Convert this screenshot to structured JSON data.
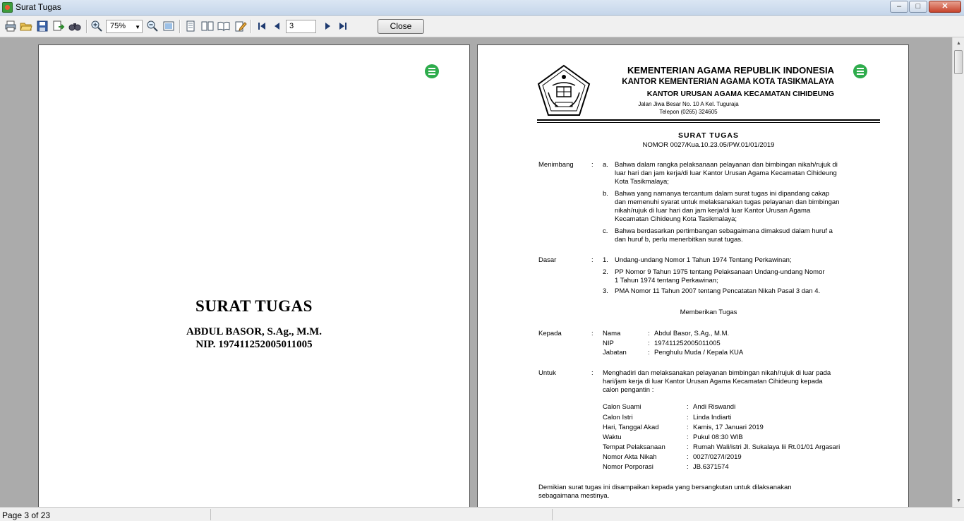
{
  "window": {
    "title": "Surat Tugas"
  },
  "toolbar": {
    "icons": [
      "print-icon",
      "open-icon",
      "save-icon",
      "export-icon",
      "find-icon",
      "zoom-in-icon",
      "zoom-out-icon",
      "fit-page-icon",
      "single-page-icon",
      "two-page-icon",
      "book-view-icon",
      "edit-icon",
      "first-page-icon",
      "prev-page-icon",
      "next-page-icon",
      "last-page-icon"
    ],
    "zoom_value": "75%",
    "page_value": "3",
    "close_label": "Close"
  },
  "cover": {
    "title": "SURAT TUGAS",
    "name": "ABDUL BASOR, S.Ag., M.M.",
    "nip": "NIP. 197411252005011005"
  },
  "letter": {
    "header": {
      "line1": "KEMENTERIAN AGAMA REPUBLIK INDONESIA",
      "line2": "KANTOR KEMENTERIAN AGAMA KOTA TASIKMALAYA",
      "line3": "KANTOR URUSAN AGAMA KECAMATAN CIHIDEUNG",
      "address": "Jalan Jiwa Besar No. 10 A Kel. Tuguraja",
      "phone": "Telepon (0265) 324605"
    },
    "title": "SURAT TUGAS",
    "nomor": "NOMOR  0027/Kua.10.23.05/PW.01/01/2019",
    "menimbang": {
      "label": "Menimbang",
      "items": [
        {
          "marker": "a.",
          "lines": [
            "Bahwa dalam rangka pelaksanaan pelayanan dan bimbingan nikah/rujuk di",
            "luar hari dan jam kerja/di luar Kantor Urusan Agama Kecamatan Cihideung",
            "Kota Tasikmalaya;"
          ]
        },
        {
          "marker": "b.",
          "lines": [
            "Bahwa yang namanya tercantum dalam surat tugas ini dipandang cakap",
            "dan memenuhi syarat untuk melaksanakan tugas pelayanan dan bimbingan",
            "nikah/rujuk di luar hari dan jam kerja/di luar Kantor Urusan Agama",
            "Kecamatan Cihideung Kota Tasikmalaya;"
          ]
        },
        {
          "marker": "c.",
          "lines": [
            "Bahwa berdasarkan pertimbangan sebagaimana dimaksud dalam huruf a",
            "dan huruf b, perlu menerbitkan surat tugas."
          ]
        }
      ]
    },
    "dasar": {
      "label": "Dasar",
      "items": [
        {
          "marker": "1.",
          "lines": [
            "Undang-undang Nomor 1 Tahun 1974 Tentang Perkawinan;"
          ]
        },
        {
          "marker": "2.",
          "lines": [
            "PP Nomor 9 Tahun 1975 tentang Pelaksanaan Undang-undang Nomor",
            "1 Tahun 1974 tentang Perkawinan;"
          ]
        },
        {
          "marker": "3.",
          "lines": [
            "PMA Nomor 11 Tahun 2007 tentang Pencatatan Nikah Pasal 3 dan 4."
          ]
        }
      ]
    },
    "memberikan": "Memberikan Tugas",
    "kepada": {
      "label": "Kepada",
      "rows": [
        {
          "key": "Nama",
          "value": "Abdul Basor, S.Ag., M.M."
        },
        {
          "key": "NIP",
          "value": "197411252005011005"
        },
        {
          "key": "Jabatan",
          "value": "Penghulu Muda / Kepala KUA"
        }
      ]
    },
    "untuk": {
      "label": "Untuk",
      "lines": [
        "Menghadiri dan melaksanakan pelayanan bimbingan nikah/rujuk di luar pada",
        "hari/jam kerja di luar Kantor Urusan Agama Kecamatan Cihideung kepada",
        "calon pengantin :"
      ],
      "rows": [
        {
          "key": "Calon Suami",
          "value": "Andi Riswandi"
        },
        {
          "key": "Calon Istri",
          "value": "Linda Indiarti"
        },
        {
          "key": "Hari, Tanggal Akad",
          "value": "Kamis, 17 Januari 2019"
        },
        {
          "key": "Waktu",
          "value": "Pukul 08:30 WIB"
        },
        {
          "key": "Tempat Pelaksanaan",
          "value": "Rumah Wali/istri Jl. Sukalaya Iii Rt.01/01 Argasari"
        },
        {
          "key": "Nomor Akta Nikah",
          "value": "0027/027/I/2019"
        },
        {
          "key": "Nomor Porporasi",
          "value": "JB.6371574"
        }
      ]
    },
    "closing": [
      "Demikian surat tugas ini disampaikan kepada yang bersangkutan untuk dilaksanakan",
      "sebagaimana mestinya."
    ]
  },
  "status": {
    "text": "Page 3 of 23"
  },
  "colors": {
    "accent_menu": "#2eac4c",
    "viewer_bg": "#ababab"
  }
}
